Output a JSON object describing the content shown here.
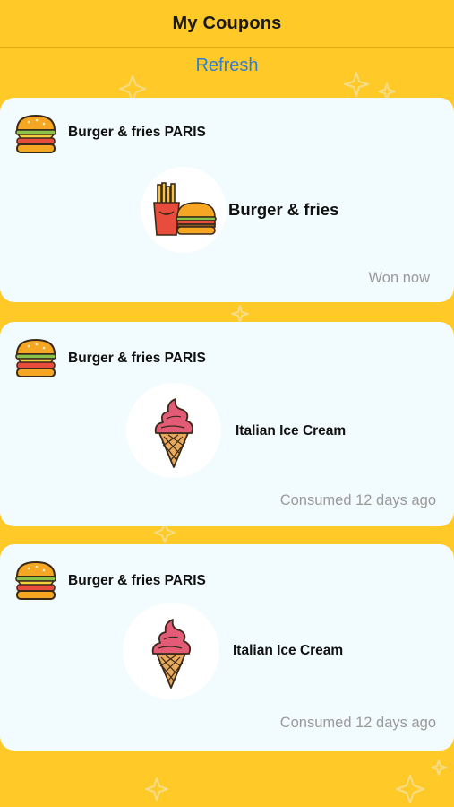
{
  "header": {
    "title": "My Coupons"
  },
  "refresh_label": "Refresh",
  "coupons": [
    {
      "store": "Burger & fries PARIS",
      "offer": "Burger & fries",
      "status": "Won now",
      "store_icon": "burger-icon",
      "offer_icon": "burger-fries-icon"
    },
    {
      "store": "Burger & fries PARIS",
      "offer": "Italian Ice Cream",
      "status": "Consumed 12 days ago",
      "store_icon": "burger-icon",
      "offer_icon": "ice-cream-icon"
    },
    {
      "store": "Burger & fries PARIS",
      "offer": "Italian Ice Cream",
      "status": "Consumed 12 days ago",
      "store_icon": "burger-icon",
      "offer_icon": "ice-cream-icon"
    }
  ],
  "colors": {
    "background": "#FFC928",
    "card": "#F2FBFD",
    "link": "#2F7FD6",
    "status_text": "#9A9A9A"
  }
}
